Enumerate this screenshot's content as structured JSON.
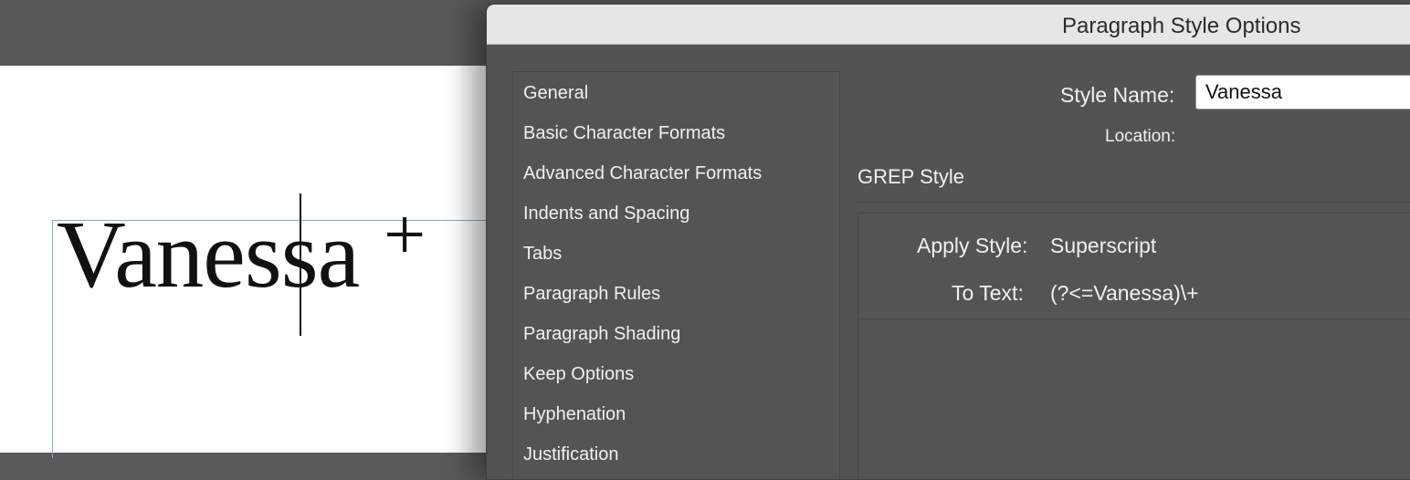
{
  "document": {
    "text": "Vanessa",
    "superscript": "+"
  },
  "dialog": {
    "title": "Paragraph Style Options",
    "categories": [
      "General",
      "Basic Character Formats",
      "Advanced Character Formats",
      "Indents and Spacing",
      "Tabs",
      "Paragraph Rules",
      "Paragraph Shading",
      "Keep Options",
      "Hyphenation",
      "Justification"
    ],
    "style_name_label": "Style Name:",
    "style_name_value": "Vanessa",
    "location_label": "Location:",
    "section_title": "GREP Style",
    "grep": {
      "apply_style_label": "Apply Style:",
      "apply_style_value": "Superscript",
      "to_text_label": "To Text:",
      "to_text_value": "(?<=Vanessa)\\+"
    }
  }
}
